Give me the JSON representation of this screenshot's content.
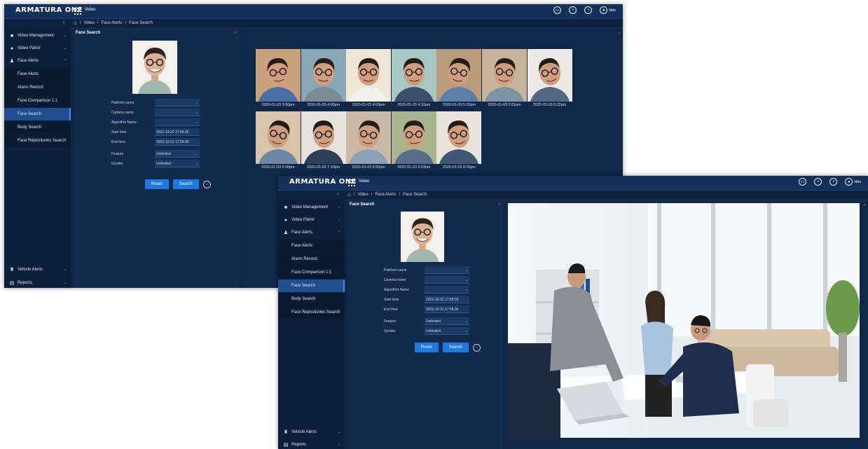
{
  "app": {
    "logo": "ARMATURA ONE",
    "module": "Video",
    "user": "Iddo"
  },
  "breadcrumb": [
    "Video",
    "Face Alerts",
    "Face Search"
  ],
  "sidebar": {
    "items": [
      {
        "label": "Video Management",
        "icon": "camera-icon"
      },
      {
        "label": "Video Patrol",
        "icon": "patrol-icon"
      },
      {
        "label": "Face Alerts",
        "icon": "face-icon"
      }
    ],
    "subitems": [
      "Face Alerts",
      "Alarm Record",
      "Face Comparison 1:1",
      "Face Search",
      "Body Search",
      "Face Repositories Search"
    ],
    "active": "Face Search",
    "bottom": [
      {
        "label": "Vehicle Alerts",
        "icon": "vehicle-icon"
      },
      {
        "label": "Reports",
        "icon": "reports-icon"
      }
    ]
  },
  "search_panel": {
    "title": "Face Search",
    "fields": [
      {
        "label": "Platform name",
        "value": ""
      },
      {
        "label": "Camera name",
        "value": ""
      },
      {
        "label": "Algorithm Name",
        "value": ""
      },
      {
        "label": "Start time",
        "value": "2022-10-22 17:58:36"
      },
      {
        "label": "End time",
        "value": "2022-10-31 17:58:36"
      },
      {
        "label": "Feature",
        "value": "Unlimited"
      },
      {
        "label": "Gender",
        "value": "Unlimited"
      }
    ],
    "reset_label": "Reset",
    "search_label": "Search"
  },
  "results": [
    "2020-01-03  3:00pm",
    "2020-01-03  4:00pm",
    "2020-01-03  4:05pm",
    "2020-01-03  4:31pm",
    "2020-01-03  5:20pm",
    "2020-01-03  5:21pm",
    "2020-01-03  5:22pm",
    "2020-01-03  6:30pm",
    "2020-01-03  7:10pm",
    "2020-01-03  8:50pm",
    "2020-01-03  9:23pm",
    "2020-01-03  9:25pm"
  ],
  "colors": {
    "background": "#0f2744",
    "sidebar": "#0b1f3a",
    "accent": "#1f7ae0",
    "active_item": "#1f4f8f"
  }
}
